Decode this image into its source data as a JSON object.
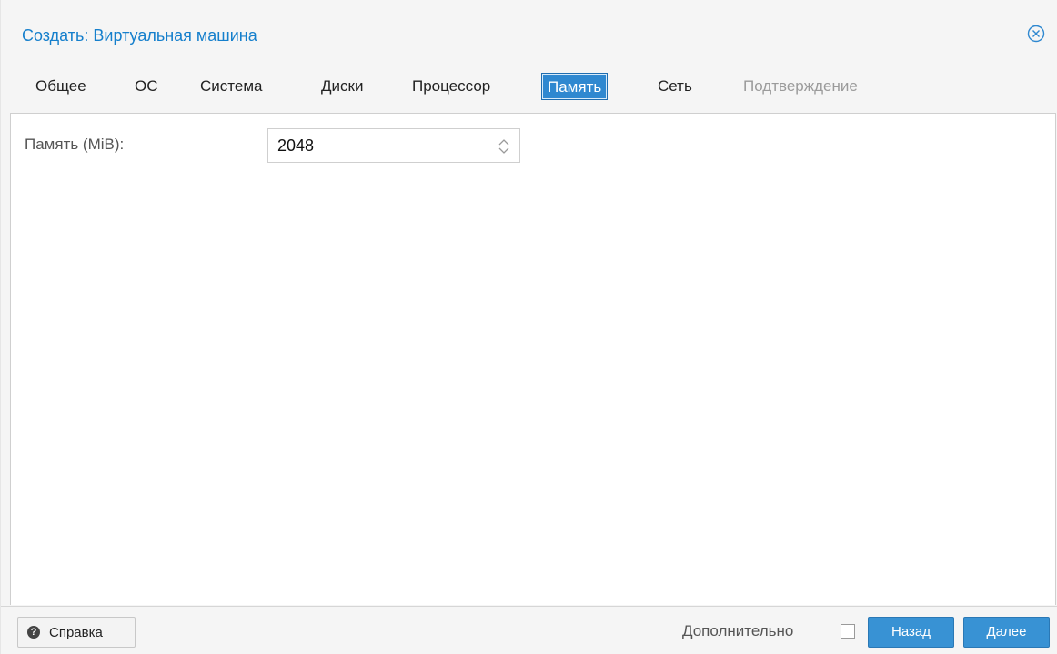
{
  "dialog": {
    "title": "Создать: Виртуальная машина",
    "close_icon": "close-circle-icon"
  },
  "tabs": [
    {
      "label": "Общее",
      "state": "normal"
    },
    {
      "label": "ОС",
      "state": "normal"
    },
    {
      "label": "Система",
      "state": "normal"
    },
    {
      "label": "Диски",
      "state": "normal"
    },
    {
      "label": "Процессор",
      "state": "normal"
    },
    {
      "label": "Память",
      "state": "active"
    },
    {
      "label": "Сеть",
      "state": "normal"
    },
    {
      "label": "Подтверждение",
      "state": "disabled"
    }
  ],
  "memory": {
    "label": "Память (MiB):",
    "value": "2048"
  },
  "footer": {
    "help_label": "Справка",
    "help_icon": "question-circle-icon",
    "advanced_label": "Дополнительно",
    "advanced_checked": false,
    "back_label": "Назад",
    "next_label": "Далее"
  },
  "colors": {
    "accent": "#157fcc",
    "active_tab": "#2f88d0",
    "primary_button": "#3892d4",
    "disabled_text": "#9b9b9b"
  }
}
